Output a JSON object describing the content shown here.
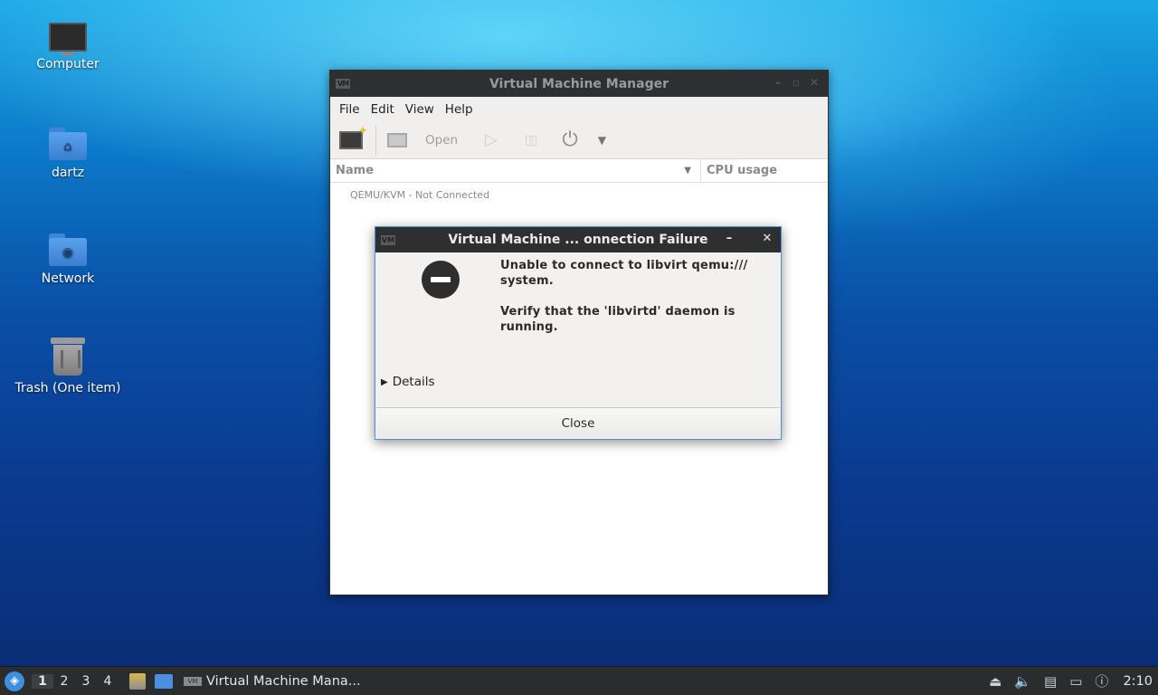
{
  "desktop": {
    "icons": [
      {
        "label": "Computer"
      },
      {
        "label": "dartz"
      },
      {
        "label": "Network"
      },
      {
        "label": "Trash (One item)"
      }
    ]
  },
  "main_window": {
    "title": "Virtual Machine Manager",
    "menu": [
      "File",
      "Edit",
      "View",
      "Help"
    ],
    "toolbar": {
      "open_label": "Open"
    },
    "columns": {
      "name": "Name",
      "cpu": "CPU usage"
    },
    "connection_row": "QEMU/KVM - Not Connected"
  },
  "dialog": {
    "title": "Virtual Machine ... onnection Failure",
    "message_line1": "Unable to connect to libvirt qemu:/// system.",
    "message_line2": "Verify that the 'libvirtd' daemon is running.",
    "details_label": "Details",
    "close_label": "Close"
  },
  "taskbar": {
    "workspaces": [
      "1",
      "2",
      "3",
      "4"
    ],
    "active_workspace": "1",
    "task_label": "Virtual Machine Mana...",
    "clock": "2:10"
  },
  "icons": {
    "computer": "monitor-icon",
    "home_folder": "home-folder-icon",
    "network": "network-folder-icon",
    "trash": "trash-icon",
    "error": "error-icon",
    "power": "power-icon"
  }
}
